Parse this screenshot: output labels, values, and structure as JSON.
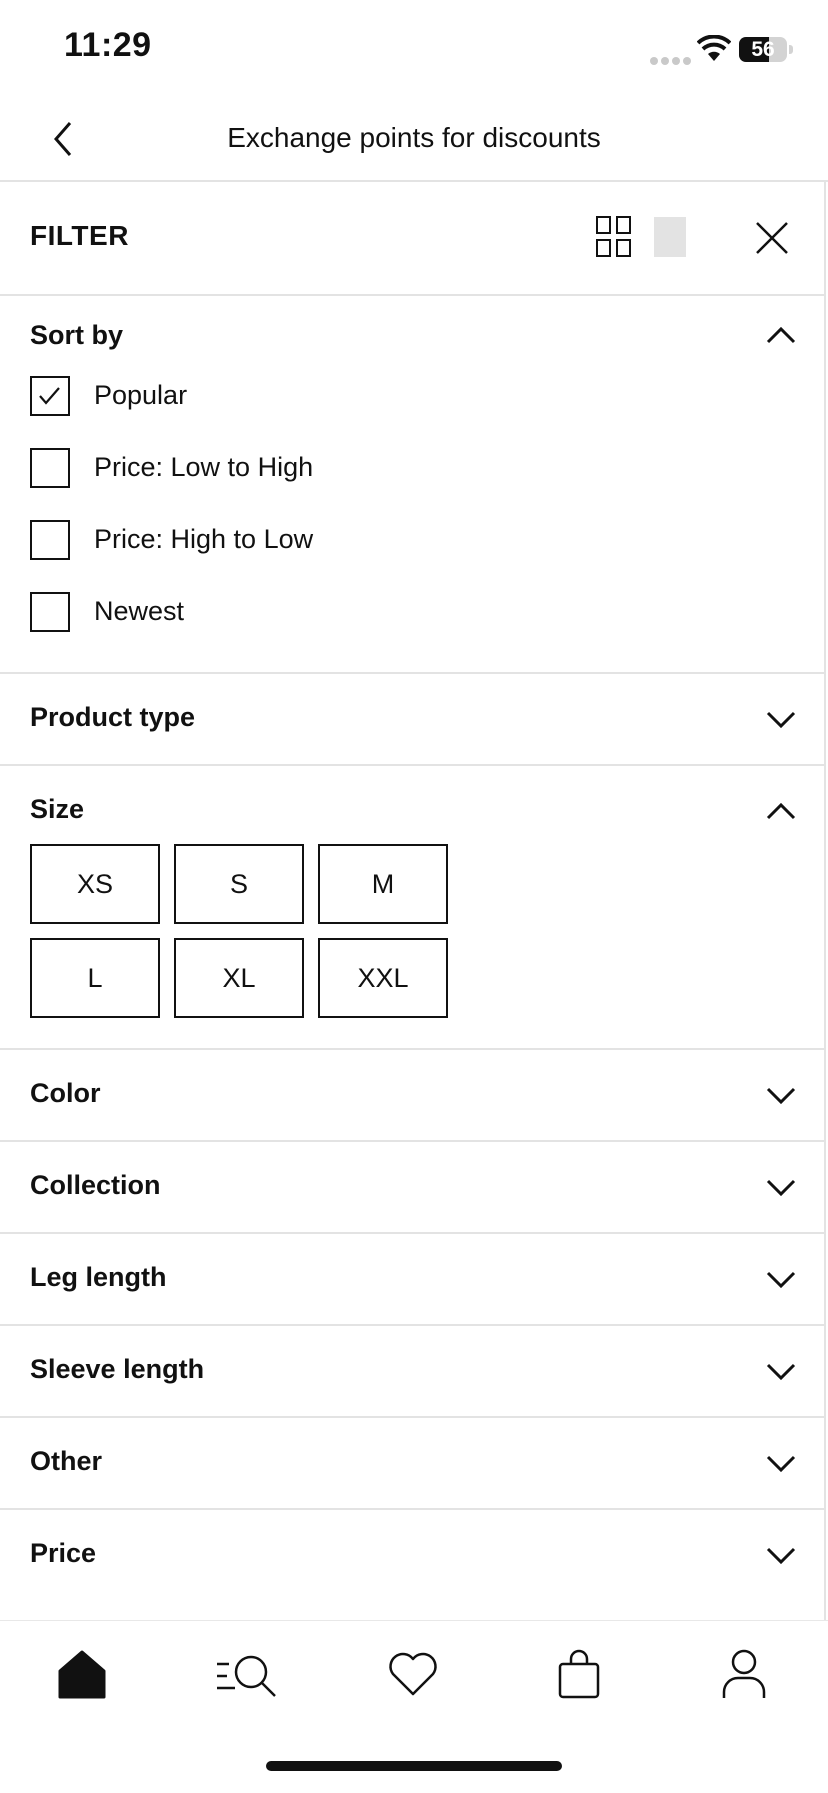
{
  "status_bar": {
    "time": "11:29",
    "battery": "56"
  },
  "nav": {
    "title": "Exchange points for discounts",
    "back_icon": "chevron-left-icon"
  },
  "filter": {
    "title": "FILTER",
    "icons": [
      "grid-view-icon",
      "single-view-icon",
      "close-icon"
    ]
  },
  "sort": {
    "title": "Sort by",
    "options": [
      {
        "label": "Popular",
        "checked": true
      },
      {
        "label": "Price: Low to High",
        "checked": false
      },
      {
        "label": "Price: High to Low",
        "checked": false
      },
      {
        "label": "Newest",
        "checked": false
      }
    ]
  },
  "sections": {
    "product_type": "Product type",
    "size": "Size",
    "color": "Color",
    "collection": "Collection",
    "leg_length": "Leg length",
    "sleeve_length": "Sleeve length",
    "other": "Other",
    "price": "Price"
  },
  "sizes": [
    "XS",
    "S",
    "M",
    "L",
    "XL",
    "XXL"
  ],
  "tab_bar": {
    "tabs": [
      "home-icon",
      "search-catalog-icon",
      "heart-icon",
      "shopping-bag-icon",
      "profile-icon"
    ],
    "active": "home-icon"
  }
}
